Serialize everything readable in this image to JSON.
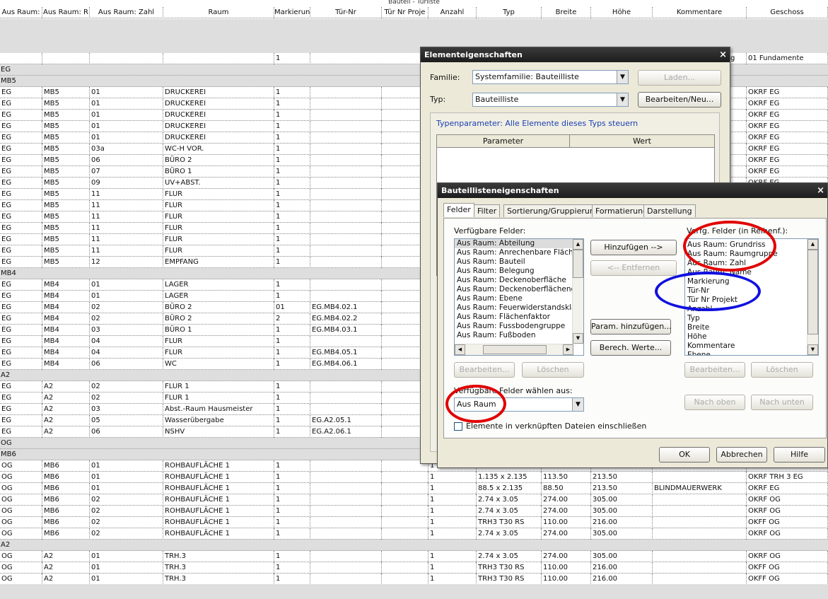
{
  "sheet_title": "Bauteil - Türliste",
  "columns": [
    "Aus Raum:",
    "Aus Raum: R",
    "Aus Raum: Zahl",
    "Raum",
    "Markierun",
    "Tür-Nr",
    "Tür Nr Proje",
    "Anzahl",
    "Typ",
    "Breite",
    "Höhe",
    "Kommentare",
    "Geschoss"
  ],
  "top_row": {
    "mark": "1",
    "partial": "g",
    "geschoss": "01 Fundamente"
  },
  "rows": [
    {
      "g": "EG"
    },
    {
      "g": "MB5"
    },
    {
      "c": [
        "EG",
        "MB5",
        "01",
        "DRUCKEREI",
        "1",
        "",
        "",
        "",
        "",
        "",
        "",
        "",
        "OKRF EG"
      ]
    },
    {
      "c": [
        "EG",
        "MB5",
        "01",
        "DRUCKEREI",
        "1",
        "",
        "",
        "",
        "",
        "",
        "",
        "",
        "OKRF EG"
      ]
    },
    {
      "c": [
        "EG",
        "MB5",
        "01",
        "DRUCKEREI",
        "1",
        "",
        "",
        "",
        "",
        "",
        "",
        "",
        "OKRF EG"
      ]
    },
    {
      "c": [
        "EG",
        "MB5",
        "01",
        "DRUCKEREI",
        "1",
        "",
        "",
        "",
        "",
        "",
        "",
        "",
        "OKRF EG"
      ]
    },
    {
      "c": [
        "EG",
        "MB5",
        "01",
        "DRUCKEREI",
        "1",
        "",
        "",
        "",
        "",
        "",
        "",
        "",
        "OKRF EG"
      ]
    },
    {
      "c": [
        "EG",
        "MB5",
        "03a",
        "WC-H VOR.",
        "1",
        "",
        "",
        "",
        "",
        "",
        "",
        "",
        "OKRF EG"
      ]
    },
    {
      "c": [
        "EG",
        "MB5",
        "06",
        "BÜRO 2",
        "1",
        "",
        "",
        "",
        "",
        "",
        "",
        "",
        "OKRF EG"
      ]
    },
    {
      "c": [
        "EG",
        "MB5",
        "07",
        "BÜRO 1",
        "1",
        "",
        "",
        "",
        "",
        "",
        "",
        "",
        "OKRF EG"
      ]
    },
    {
      "c": [
        "EG",
        "MB5",
        "09",
        "UV+ABST.",
        "1",
        "",
        "",
        "",
        "",
        "",
        "",
        "",
        "OKRF EG"
      ]
    },
    {
      "c": [
        "EG",
        "MB5",
        "11",
        "FLUR",
        "1",
        "",
        "",
        "",
        "",
        "",
        "",
        "",
        ""
      ]
    },
    {
      "c": [
        "EG",
        "MB5",
        "11",
        "FLUR",
        "1",
        "",
        "",
        "",
        "",
        "",
        "",
        "",
        ""
      ]
    },
    {
      "c": [
        "EG",
        "MB5",
        "11",
        "FLUR",
        "1",
        "",
        "",
        "",
        "",
        "",
        "",
        "",
        ""
      ]
    },
    {
      "c": [
        "EG",
        "MB5",
        "11",
        "FLUR",
        "1",
        "",
        "",
        "",
        "",
        "",
        "",
        "",
        ""
      ]
    },
    {
      "c": [
        "EG",
        "MB5",
        "11",
        "FLUR",
        "1",
        "",
        "",
        "",
        "",
        "",
        "",
        "",
        ""
      ]
    },
    {
      "c": [
        "EG",
        "MB5",
        "11",
        "FLUR",
        "1",
        "",
        "",
        "",
        "",
        "",
        "",
        "",
        ""
      ]
    },
    {
      "c": [
        "EG",
        "MB5",
        "12",
        "EMPFANG",
        "1",
        "",
        "",
        "",
        "",
        "",
        "",
        "",
        ""
      ]
    },
    {
      "g": "MB4"
    },
    {
      "c": [
        "EG",
        "MB4",
        "01",
        "LAGER",
        "1",
        "",
        "",
        "",
        "",
        "",
        "",
        "",
        ""
      ]
    },
    {
      "c": [
        "EG",
        "MB4",
        "01",
        "LAGER",
        "1",
        "",
        "",
        "",
        "",
        "",
        "",
        "",
        ""
      ]
    },
    {
      "c": [
        "EG",
        "MB4",
        "02",
        "BÜRO 2",
        "01",
        "EG.MB4.02.1",
        "",
        "",
        "",
        "",
        "",
        "",
        ""
      ]
    },
    {
      "c": [
        "EG",
        "MB4",
        "02",
        "BÜRO 2",
        "2",
        "EG.MB4.02.2",
        "",
        "",
        "",
        "",
        "",
        "",
        ""
      ]
    },
    {
      "c": [
        "EG",
        "MB4",
        "03",
        "BÜRO 1",
        "1",
        "EG.MB4.03.1",
        "",
        "",
        "",
        "",
        "",
        "",
        ""
      ]
    },
    {
      "c": [
        "EG",
        "MB4",
        "04",
        "FLUR",
        "1",
        "",
        "",
        "",
        "",
        "",
        "",
        "",
        ""
      ]
    },
    {
      "c": [
        "EG",
        "MB4",
        "04",
        "FLUR",
        "1",
        "EG.MB4.05.1",
        "",
        "",
        "",
        "",
        "",
        "",
        ""
      ]
    },
    {
      "c": [
        "EG",
        "MB4",
        "06",
        "WC",
        "1",
        "EG.MB4.06.1",
        "",
        "",
        "",
        "",
        "",
        "",
        ""
      ]
    },
    {
      "g": "A2"
    },
    {
      "c": [
        "EG",
        "A2",
        "02",
        "FLUR 1",
        "1",
        "",
        "",
        "",
        "",
        "",
        "",
        "",
        ""
      ]
    },
    {
      "c": [
        "EG",
        "A2",
        "02",
        "FLUR 1",
        "1",
        "",
        "",
        "",
        "",
        "",
        "",
        "",
        ""
      ]
    },
    {
      "c": [
        "EG",
        "A2",
        "03",
        "Abst.-Raum Hausmeister",
        "1",
        "",
        "",
        "",
        "",
        "",
        "",
        "",
        ""
      ]
    },
    {
      "c": [
        "EG",
        "A2",
        "05",
        "Wasserübergabe",
        "1",
        "EG.A2.05.1",
        "",
        "",
        "",
        "",
        "",
        "",
        ""
      ]
    },
    {
      "c": [
        "EG",
        "A2",
        "06",
        "NSHV",
        "1",
        "EG.A2.06.1",
        "",
        "",
        "",
        "",
        "",
        "",
        ""
      ]
    },
    {
      "g": "OG"
    },
    {
      "g": "MB6"
    },
    {
      "c": [
        "OG",
        "MB6",
        "01",
        "ROHBAUFLÄCHE 1",
        "1",
        "",
        "",
        "1",
        "",
        "",
        "",
        "",
        ""
      ]
    },
    {
      "c": [
        "OG",
        "MB6",
        "01",
        "ROHBAUFLÄCHE 1",
        "1",
        "",
        "",
        "1",
        "1.135 x 2.135",
        "113.50",
        "213.50",
        "",
        "OKRF TRH 3 EG"
      ]
    },
    {
      "c": [
        "OG",
        "MB6",
        "01",
        "ROHBAUFLÄCHE 1",
        "1",
        "",
        "",
        "1",
        "88.5 x 2.135",
        "88.50",
        "213.50",
        "BLINDMAUERWERK",
        "OKRF EG"
      ]
    },
    {
      "c": [
        "OG",
        "MB6",
        "02",
        "ROHBAUFLÄCHE 1",
        "1",
        "",
        "",
        "1",
        "2.74 x 3.05",
        "274.00",
        "305.00",
        "",
        "OKRF OG"
      ]
    },
    {
      "c": [
        "OG",
        "MB6",
        "02",
        "ROHBAUFLÄCHE 1",
        "1",
        "",
        "",
        "1",
        "2.74 x 3.05",
        "274.00",
        "305.00",
        "",
        "OKRF OG"
      ]
    },
    {
      "c": [
        "OG",
        "MB6",
        "02",
        "ROHBAUFLÄCHE 1",
        "1",
        "",
        "",
        "1",
        "TRH3 T30 RS",
        "110.00",
        "216.00",
        "",
        "OKFF OG"
      ]
    },
    {
      "c": [
        "OG",
        "MB6",
        "02",
        "ROHBAUFLÄCHE 1",
        "1",
        "",
        "",
        "1",
        "2.74 x 3.05",
        "274.00",
        "305.00",
        "",
        "OKRF OG"
      ]
    },
    {
      "g": "A2"
    },
    {
      "c": [
        "OG",
        "A2",
        "01",
        "TRH.3",
        "1",
        "",
        "",
        "1",
        "2.74 x 3.05",
        "274.00",
        "305.00",
        "",
        "OKRF OG"
      ]
    },
    {
      "c": [
        "OG",
        "A2",
        "01",
        "TRH.3",
        "1",
        "",
        "",
        "1",
        "TRH3 T30 RS",
        "110.00",
        "216.00",
        "",
        "OKFF OG"
      ]
    },
    {
      "c": [
        "OG",
        "A2",
        "01",
        "TRH.3",
        "1",
        "",
        "",
        "1",
        "TRH3 T30 RS",
        "110.00",
        "216.00",
        "",
        "OKFF OG"
      ]
    }
  ],
  "elem_dialog": {
    "title": "Elementeigenschaften",
    "close": "×",
    "family_label": "Familie:",
    "family_value": "Systemfamilie: Bauteilliste",
    "load_button": "Laden...",
    "type_label": "Typ:",
    "type_value": "Bauteilliste",
    "edit_button": "Bearbeiten/Neu...",
    "type_params_label": "Typenparameter: Alle Elemente dieses Typs steuern",
    "col_parameter": "Parameter",
    "col_value": "Wert"
  },
  "sched_dialog": {
    "title": "Bauteillisteneigenschaften",
    "close": "×",
    "tabs": [
      "Felder",
      "Filter",
      "Sortierung/Gruppierung",
      "Formatierung",
      "Darstellung"
    ],
    "available_label": "Verfügbare Felder:",
    "available_fields": [
      "Aus Raum: Abteilung",
      "Aus Raum: Anrechenbare Fläche",
      "Aus Raum: Bauteil",
      "Aus Raum: Belegung",
      "Aus Raum: Deckenoberfläche",
      "Aus Raum: Deckenoberflächengr",
      "Aus Raum: Ebene",
      "Aus Raum: Feuerwiderstandsklass",
      "Aus Raum: Flächenfaktor",
      "Aus Raum: Fussbodengruppe",
      "Aus Raum: Fußboden"
    ],
    "add_button": "Hinzufügen -->",
    "remove_button": "<-- Entfernen",
    "param_add_button": "Param. hinzufügen...",
    "calc_button": "Berech. Werte...",
    "selected_label": "Verfg. Felder (in Reihenf.):",
    "selected_fields": [
      "Aus Raum: Grundriss",
      "Aus Raum: Raumgruppe",
      "Aus Raum: Zahl",
      "Aus Raum: Name",
      "Markierung",
      "Tür-Nr",
      "Tür Nr Projekt",
      "Anzahl",
      "Typ",
      "Breite",
      "Höhe",
      "Kommentare",
      "Ebene"
    ],
    "edit_left": "Bearbeiten...",
    "delete_left": "Löschen",
    "edit_right": "Bearbeiten...",
    "delete_right": "Löschen",
    "choose_from_label": "Verfügbare Felder wählen aus:",
    "choose_from_value": "Aus Raum",
    "move_up": "Nach oben",
    "move_down": "Nach unten",
    "include_linked": "Elemente in verknüpften Dateien einschließen",
    "ok": "OK",
    "cancel": "Abbrechen",
    "help": "Hilfe"
  },
  "annotation_colors": {
    "red": "#e00000",
    "blue": "#1010e0"
  }
}
